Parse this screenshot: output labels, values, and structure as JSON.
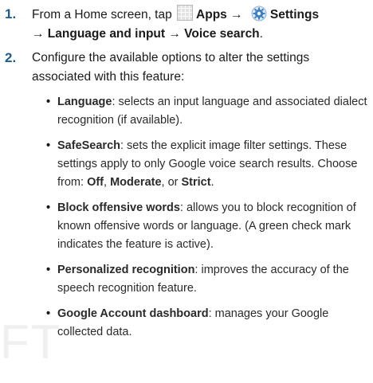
{
  "steps": [
    {
      "number": "1.",
      "parts": {
        "pre": "From a Home screen, tap",
        "apps": "Apps",
        "arrow1": "→",
        "settings": "Settings",
        "line2": "→ Language and input → Voice search",
        "end": "."
      }
    },
    {
      "number": "2.",
      "text": "Configure the available options to alter the settings associated with this feature:"
    }
  ],
  "bullets": [
    {
      "term": "Language",
      "desc": ": selects an input language and associated dialect recognition (if available)."
    },
    {
      "term": "SafeSearch",
      "desc": ": sets the explicit image filter settings. These settings apply to only Google voice search results. Choose from: ",
      "opt1": "Off",
      "sep1": ", ",
      "opt2": "Moderate",
      "sep2": ", or ",
      "opt3": "Strict",
      "end": "."
    },
    {
      "term": "Block offensive words",
      "desc": ": allows you to block recognition of known offensive words or language. (A green check mark indicates the feature is active)."
    },
    {
      "term": "Personalized recognition",
      "desc": ": improves the accuracy of the speech recognition feature."
    },
    {
      "term": "Google Account dashboard",
      "desc": ": manages your Google collected data."
    }
  ],
  "watermark": "FT",
  "colors": {
    "number": "#1f5c8e",
    "settings_icon": "#3b7fc4"
  }
}
